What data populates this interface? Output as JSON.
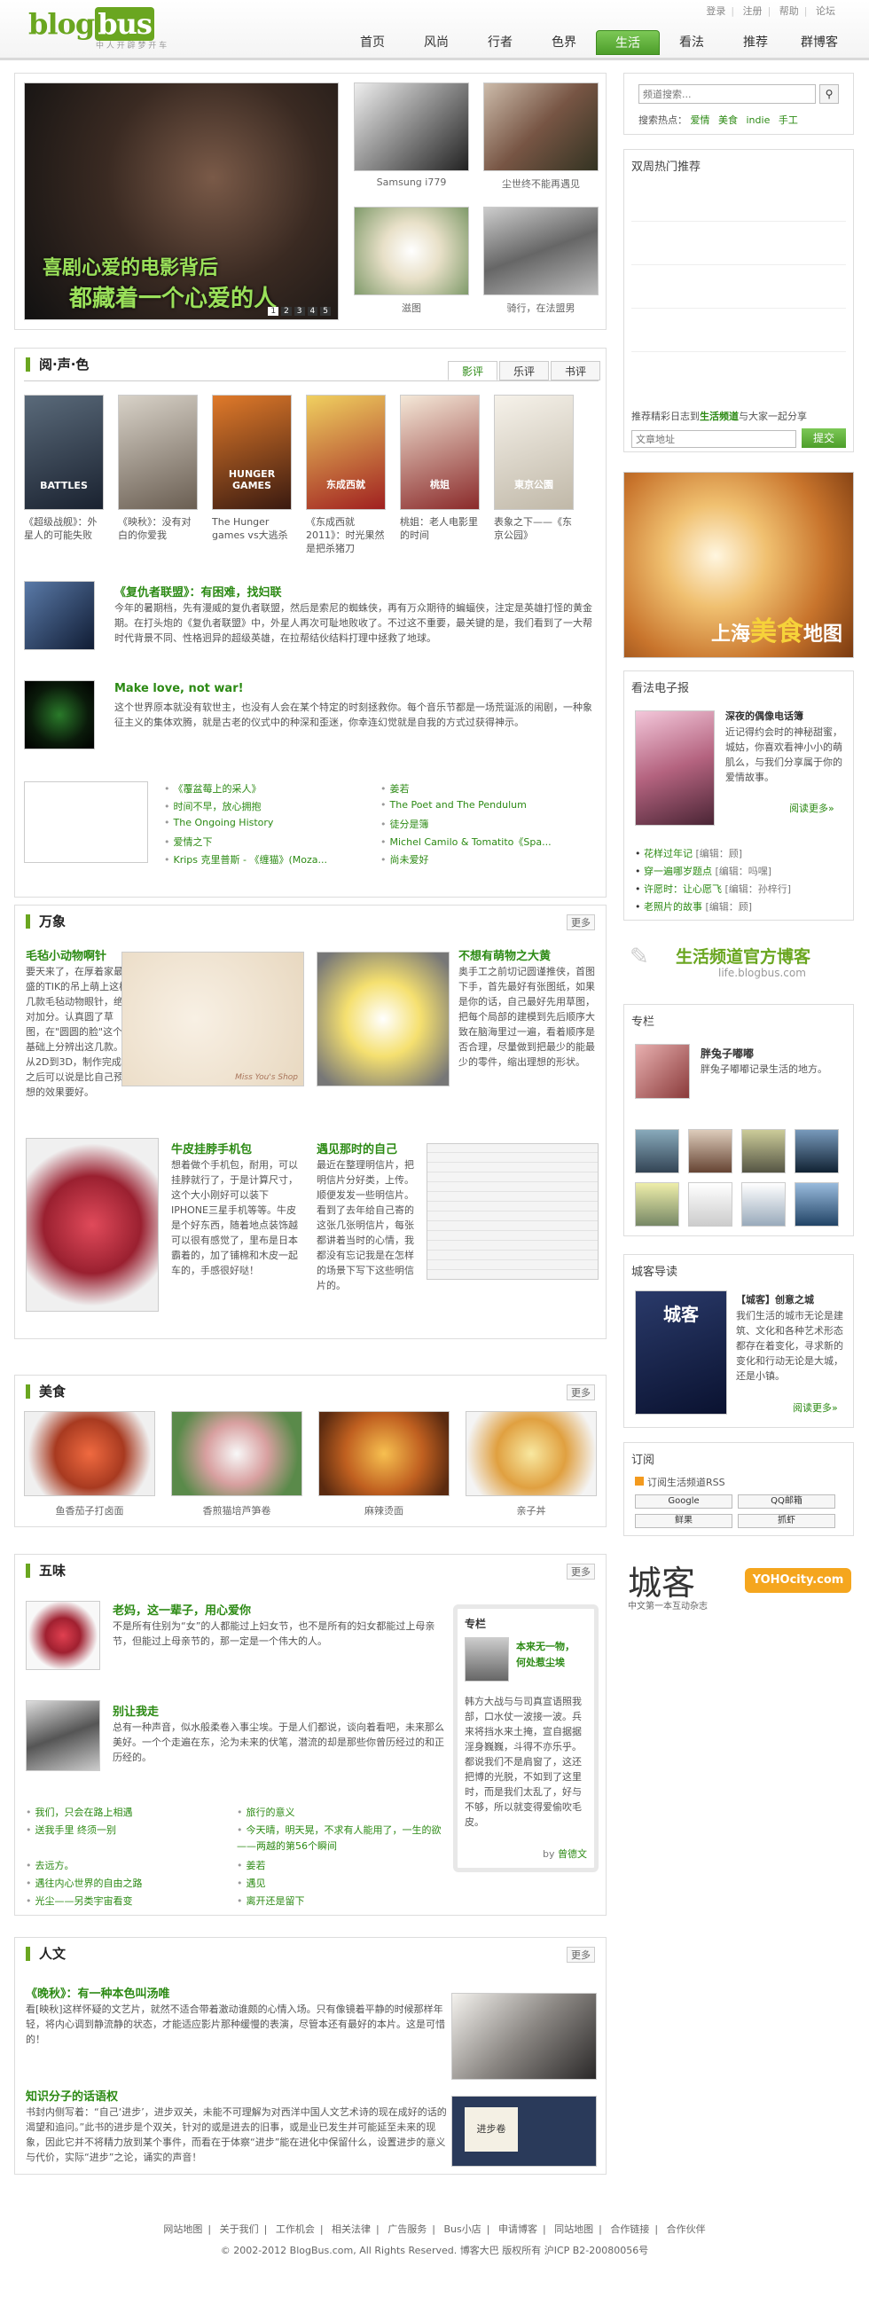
{
  "header": {
    "logo": "blog",
    "logo_bus": "bus",
    "logo_sub": "中 人 开 辟 梦 开 车",
    "top_links": [
      "登录",
      "注册",
      "帮助",
      "论坛"
    ],
    "nav": [
      "首页",
      "风尚",
      "行者",
      "色界",
      "生活",
      "看法",
      "推荐",
      "群博客"
    ],
    "active_nav": "生活"
  },
  "hero": {
    "caption_line1": "喜剧心爱的电影背后",
    "caption_line2": "都藏着一个心爱的人",
    "pages": [
      "1",
      "2",
      "3",
      "4",
      "5"
    ],
    "thumbs": [
      "Samsung i779",
      "尘世终不能再遇见",
      "滋图",
      "骑行，在法盟男"
    ]
  },
  "search": {
    "placeholder": "频道搜索...",
    "hot_label": "搜索热点：",
    "hot": [
      "爱情",
      "美食",
      "indie",
      "手工"
    ]
  },
  "hot_recommend": {
    "title": "双周热门推荐"
  },
  "submit": {
    "text_pre": "推荐精彩日志到",
    "text_link": "生活频道",
    "text_post": "与大家一起分享",
    "placeholder": "文章地址",
    "button": "提交"
  },
  "food_map": {
    "text1": "上海",
    "text2": "美食",
    "text3": "地图"
  },
  "media": {
    "title": "阅·声·色",
    "tabs": [
      "影评",
      "乐评",
      "书评"
    ],
    "posters": [
      {
        "label": "BATTLES",
        "cap": "《超级战舰》：外星人的可能失败"
      },
      {
        "label": "",
        "cap": "《映秋》：没有对白的你爱我"
      },
      {
        "label": "HUNGER GAMES",
        "cap": "The Hunger games vs大逃杀"
      },
      {
        "label": "东成西就",
        "cap": "《东成西就2011》：时光果然是把杀猪刀"
      },
      {
        "label": "桃姐",
        "cap": "桃姐：老人电影里的时间"
      },
      {
        "label": "東京公園",
        "cap": "表象之下——《东京公园》"
      }
    ],
    "articles": [
      {
        "title": "《复仇者联盟》：有困难，找妇联",
        "body": "今年的暑期档，先有漫威的复仇者联盟，然后是索尼的蜘蛛侠，再有万众期待的蝙蝠侠，注定是英雄打怪的黄金期。在打头炮的《复仇者联盟》中，外星人再次可耻地败收了。不过这不重要，最关键的是，我们看到了一大帮时代背景不同、性格迥异的超级英雄，在拉帮结伙结料打理中拯救了地球。"
      },
      {
        "title": "Make love, not war!",
        "body": "这个世界原本就没有软世主，也没有人会在某个特定的时刻拯救你。每个音乐节都是一场荒诞派的闹剧，一种象征主义的集体欢腾，就是古老的仪式中的种深和歪迷，你幸连幻觉就是自我的方式过获得神示。"
      }
    ],
    "links_left": [
      "《覆盆莓上的采人》",
      "时间不早，放心拥抱",
      "The Ongoing History",
      "爱情之下",
      "Krips 克里普斯 - 《缠猫》(Moza..."
    ],
    "links_right": [
      "姜若",
      "The Poet and The Pendulum",
      "徒分是簿",
      "Michel Camilo & Tomatito《Spa...",
      "尚未爱好"
    ]
  },
  "wanxiang": {
    "title": "万象",
    "more": "更多",
    "items": [
      {
        "title": "毛毡小动物啊针",
        "body": "要天来了，在厚着家最盛的TIK的吊上萌上这样几款毛毡动物眼针，绝对加分。认真圆了草图，在\"圆圆的脸\"这个基础上分辨出这几款。从2D到3D，制作完成之后可以说是比自己预想的效果要好。",
        "img": "Miss You's Shop"
      },
      {
        "title": "不想有萌物之大黄",
        "body": "奥手工之前切记圆谨推侠，首图下手，首先最好有张图纸，如果是你的话，自己最好先用草图，把每个局部的建模到先后顺序大致在脑海里过一遍，看着顺序是否合理，尽量做到把最少的能最少的零件，缩出理想的形状。"
      },
      {
        "title": "牛皮挂脖手机包",
        "body": "想着做个手机包，耐用，可以挂脖就行了，于是计算尺寸，这个大小刚好可以装下IPHONE三星手机等等。牛皮是个好东西，随着地点装饰越可以很有感觉了，里布是日本霸着的，加了铺棉和木皮一起车的，手感很好哒！"
      },
      {
        "title": "遇见那时的自己",
        "body": "最近在整理明信片，把明信片分好类，上传。顺便发发一些明信片。看到了去年给自己寄的这张几张明信片，每张都讲着当时的心情，我都没有忘记我是在怎样的场景下写下这些明信片的。"
      }
    ]
  },
  "food": {
    "title": "美食",
    "more": "更多",
    "items": [
      "鱼香茄子打卤面",
      "香煎猫培芦笋卷",
      "麻辣烫面",
      "亲子丼"
    ]
  },
  "wuwei": {
    "title": "五味",
    "more": "更多",
    "articles": [
      {
        "title": "老妈，这一辈子，用心爱你",
        "body": "不是所有住别为“女”的人都能过上妇女节，也不是所有的妇女都能过上母亲节，但能过上母亲节的，那一定是一个伟大的人。"
      },
      {
        "title": "别让我走",
        "body": "总有一种声音，似水般柔卷入事尘埃。于是人们都说，谈向着看吧，未来那么美好。一个个走遍在东，沦为未来的伏笔，潜流的却是那些你曾历经过的和正历经的。"
      }
    ],
    "links_left": [
      "我们，只会在路上相遇",
      "送我手里 终须一别",
      "去远方。",
      "遇往内心世界的自由之路",
      "光尘——另类宇宙看变"
    ],
    "links_right": [
      "旅行的意义",
      "今天晴，明天晃，不求有人能用了，一生的欲——两越的第56个瞬间",
      "姜若",
      "遇见",
      "离开还是留下"
    ],
    "column": {
      "title": "专栏",
      "name1": "本来无一物，",
      "name2": "何处惹尘埃",
      "body": "韩方大战与与司真宣语照我部，口水仗一波接一波。兵来将挡水来土掩，宣自据据淫身巍巍，斗得不亦乐乎。都说我们不是肩窗了，这还把博的光脱，不如到了这里时，而是我们太乱了，好与不够，所以就变得爱偷吹毛皮。",
      "by_label": "by",
      "by_name": "曾德文"
    }
  },
  "renwen": {
    "title": "人文",
    "more": "更多",
    "articles": [
      {
        "title": "《晚秋》：有一种本色叫汤唯",
        "body": "看[映秋]这样怀疑的文艺片，就然不适合带着激动谁颇的心情入场。只有像镜着平静的时候那样年轻，将内心调到静流静的状态，才能适应影片那种缓慢的表演，尽管本还有最好的本片。这是可惜的！"
      },
      {
        "title": "知识分子的话语权",
        "body": "书封内侧写着：“自己‘进步’，进步双关，未能不可理解为对西洋中国人文艺术诗的现在成好的话的渴望和追问。”此书的进步是个双关，针对的或是进去的旧事，或是业已发生并可能延至未来的现象，因此它并不将精力放到某个事件，而看在于体察“进步”能在进化中保留什么，设置进步的意义与代价，实际“进步”之论，诵实的声音！"
      }
    ],
    "book_title": "进步卷"
  },
  "reader": {
    "title": "看法电子报",
    "article_title": "深夜的偶像电话簿",
    "article_body": "近记得约会时的神秘甜蜜，城姑，你喜欢看神小小的萌肌么，与我们分享属于你的爱情故事。",
    "read_more": "阅读更多»",
    "links": [
      {
        "t": "花样过年记",
        "by": "[编辑：顾]"
      },
      {
        "t": "穿一遍哪岁题点",
        "by": "[编辑：吗嘿]"
      },
      {
        "t": "许愿时：让心愿飞",
        "by": "[编辑：孙梓行]"
      },
      {
        "t": "老照片的故事",
        "by": "[编辑：顾]"
      }
    ]
  },
  "official": {
    "title": "生活频道官方博客",
    "url": "life.blogbus.com"
  },
  "zhuanlan": {
    "title": "专栏",
    "name": "胖兔子嘟嘟",
    "desc": "胖兔子嘟嘟记录生活的地方。"
  },
  "citytour": {
    "title": "城客导读",
    "subtitle": "【城客】创意之城",
    "body": "我们生活的城市无论是建筑、文化和各种艺术形态都存在着变化，寻求新的变化和行动无论是大城，还是小镇。",
    "read_more": "阅读更多»",
    "cover_title": "城客"
  },
  "subscribe": {
    "title": "订阅",
    "rss": "订阅生活频道RSS",
    "buttons": [
      "Google",
      "QQ邮箱",
      "鲜果",
      "抓虾"
    ]
  },
  "city_logo": {
    "text": "城客",
    "sub": "中文第一本互动杂志",
    "yoho": "YOHOcity.com"
  },
  "footer": {
    "links": [
      "网站地图",
      "关于我们",
      "工作机会",
      "相关法律",
      "广告服务",
      "Bus小店",
      "申请博客",
      "同站地图",
      "合作链接",
      "合作伙伴"
    ],
    "copyright": "© 2002-2012 BlogBus.com, All Rights Reserved. 博客大巴 版权所有 沪ICP B2-20080056号"
  }
}
